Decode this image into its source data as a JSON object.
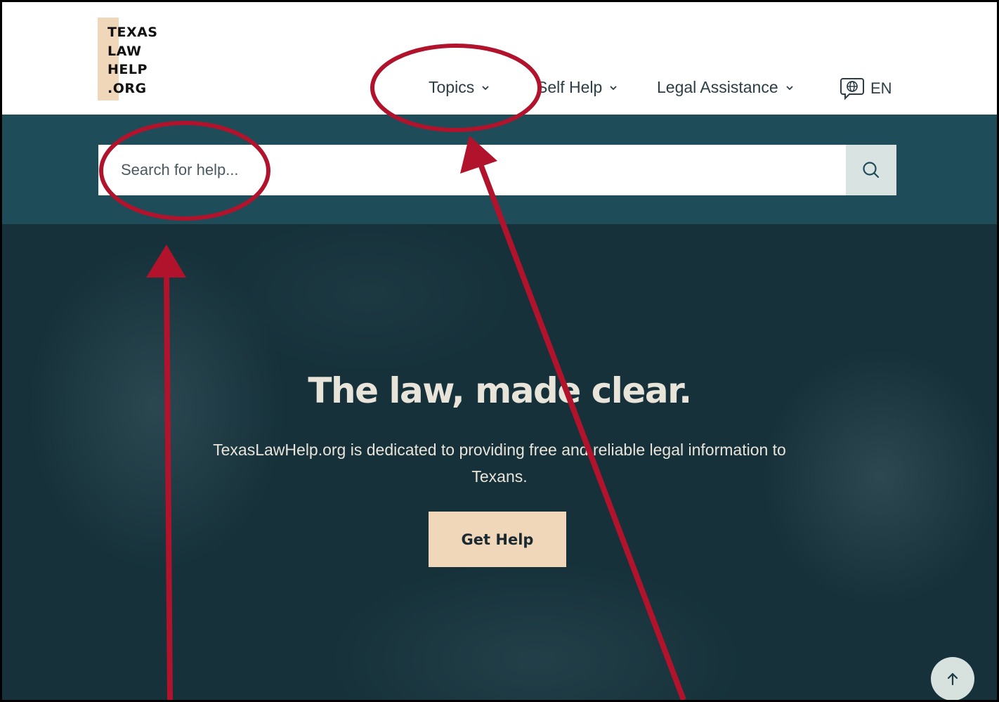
{
  "logo": {
    "text": "TEXAS\nLAW\nHELP\n.ORG",
    "accent_color": "#f1d7ba"
  },
  "nav": {
    "items": [
      {
        "label": "Topics"
      },
      {
        "label": "Self Help"
      },
      {
        "label": "Legal Assistance"
      }
    ],
    "language": "EN",
    "language_icon": "globe-speech-icon"
  },
  "search": {
    "placeholder": "Search for help...",
    "value": "",
    "icon": "search-icon",
    "band_color": "#1e4d59"
  },
  "hero": {
    "title": "The law, made clear.",
    "subtitle": "TexasLawHelp.org is dedicated to providing free and reliable legal information to Texans.",
    "cta_label": "Get Help",
    "cta_color": "#f1d7ba"
  },
  "scroll_top": {
    "icon": "arrow-up-icon"
  },
  "annotations": {
    "color": "#b0132b",
    "circles": [
      "search-input-highlight",
      "topics-nav-highlight"
    ],
    "arrows": [
      "arrow-to-search",
      "arrow-to-topics"
    ]
  }
}
